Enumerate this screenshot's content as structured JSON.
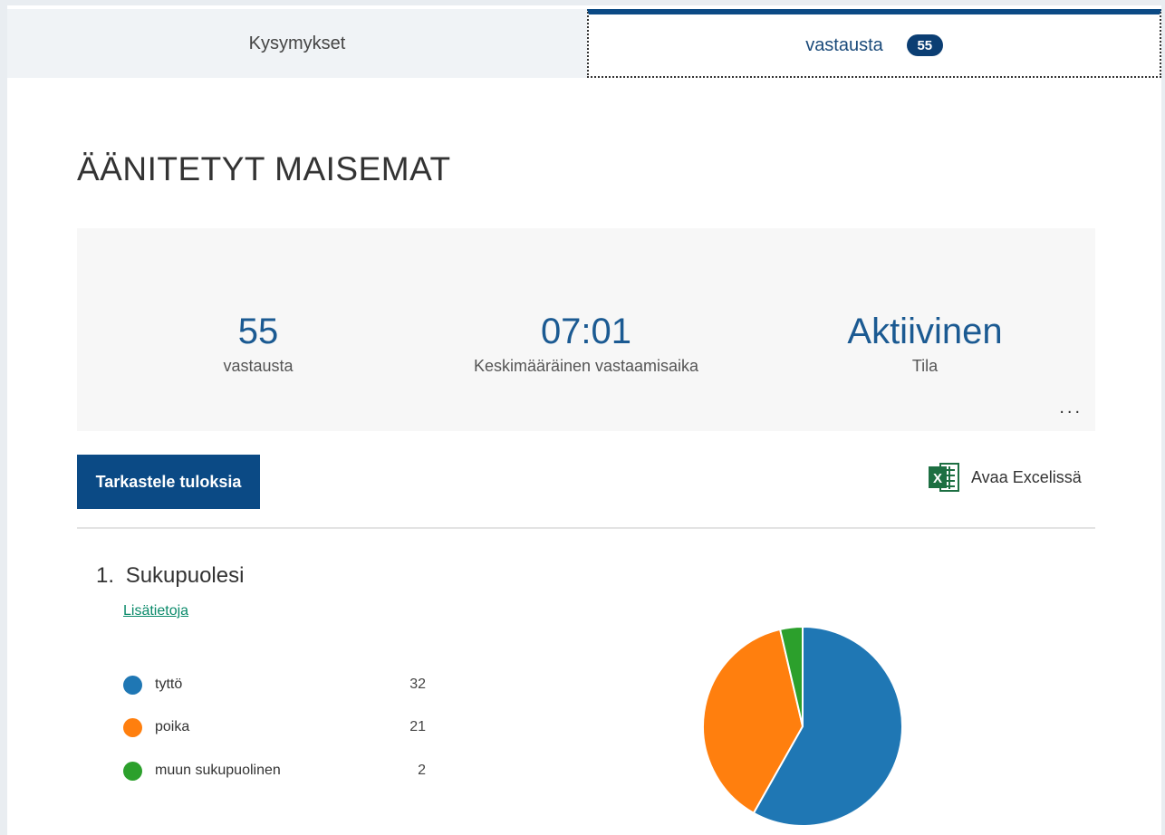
{
  "tabs": [
    {
      "label": "Kysymykset"
    },
    {
      "label": "vastausta",
      "badge": "55"
    }
  ],
  "form": {
    "title": "ÄÄNITETYT MAISEMAT"
  },
  "stats": [
    {
      "value": "55",
      "label": "vastausta"
    },
    {
      "value": "07:01",
      "label": "Keskimääräinen vastaamisaika"
    },
    {
      "value": "Aktiivinen",
      "label": "Tila"
    }
  ],
  "more_label": "...",
  "actions": {
    "view_results": "Tarkastele tuloksia",
    "open_excel": "Avaa Excelissä",
    "excel_icon_letter": "X"
  },
  "question": {
    "number": "1.",
    "title": "Sukupuolesi",
    "more_info": "Lisätietoja"
  },
  "chart_data": {
    "type": "pie",
    "categories": [
      "tyttö",
      "poika",
      "muun sukupuolinen"
    ],
    "values": [
      32,
      21,
      2
    ],
    "colors": [
      "#1f77b4",
      "#ff7f0e",
      "#2ca02c"
    ],
    "title": ""
  },
  "icons": {
    "excel": "excel-icon",
    "more": "more-icon"
  },
  "colors": {
    "accent": "#0b4a85",
    "link": "#0a8a6a"
  }
}
